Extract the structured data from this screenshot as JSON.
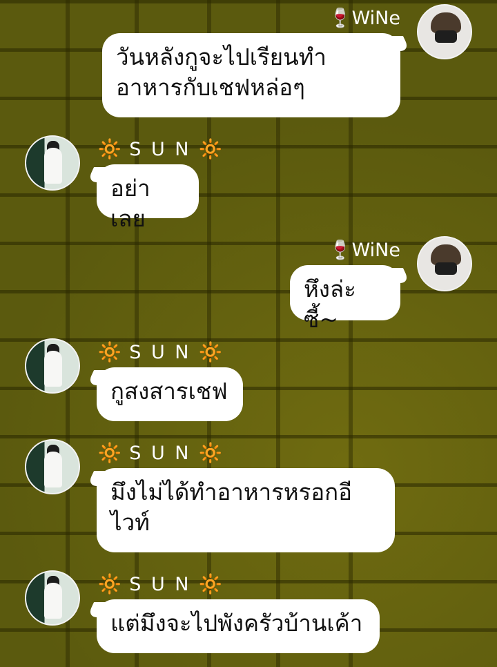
{
  "names": {
    "wine": {
      "emoji": "🍷",
      "label": "WiNe"
    },
    "sun": {
      "emoji_left": "🔆",
      "label": "S U N",
      "emoji_right": "🔆"
    }
  },
  "messages": [
    {
      "sender": "WiNe",
      "text": "วันหลังกูจะไปเรียนทำอาหารกับเชฟหล่อๆ"
    },
    {
      "sender": "SUN",
      "text": "อย่าเลย"
    },
    {
      "sender": "WiNe",
      "text": "หึงล่ะซี้~"
    },
    {
      "sender": "SUN",
      "text": "กูสงสารเชฟ"
    },
    {
      "sender": "SUN",
      "text": "มึงไม่ได้ทำอาหารหรอกอีไวท์"
    },
    {
      "sender": "SUN",
      "text": "แต่มึงจะไปพังครัวบ้านเค้า"
    }
  ],
  "colors": {
    "bubble": "#ffffff",
    "name_text": "#ffffff",
    "wall": "#5b5a0e"
  }
}
